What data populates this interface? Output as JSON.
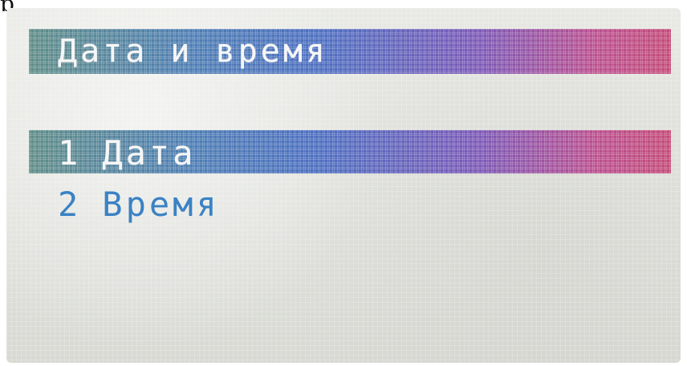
{
  "top_glyph": "р",
  "screen": {
    "title": "Дата и время",
    "menu": {
      "items": [
        {
          "number": "1",
          "label": "Дата",
          "selected": true
        },
        {
          "number": "2",
          "label": "Время",
          "selected": false
        }
      ]
    },
    "colors": {
      "background": "#e3e4df",
      "highlight_start": "#5e8c86",
      "highlight_end": "#c34a78",
      "item_text": "#3a82c4",
      "highlight_text": "#f6f6f6"
    }
  }
}
